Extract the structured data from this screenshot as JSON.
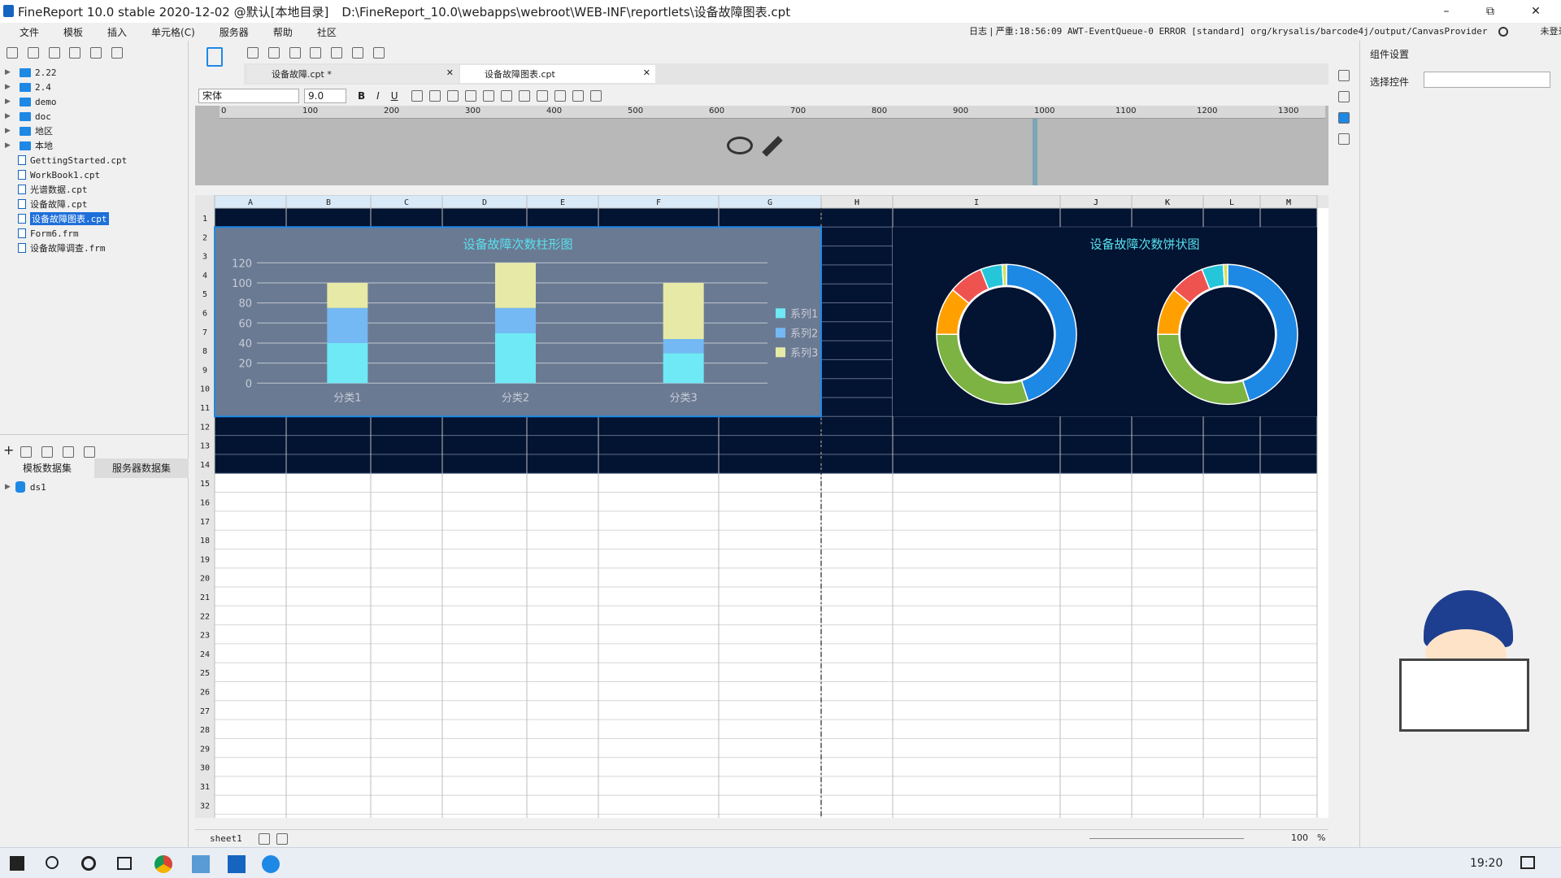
{
  "titlebar": {
    "app": "FineReport 10.0 stable 2020-12-02 @默认[本地目录]",
    "path": "D:\\FineReport_10.0\\webapps\\webroot\\WEB-INF\\reportlets\\设备故障图表.cpt",
    "min": "–",
    "max": "⧉",
    "close": "✕"
  },
  "menu": [
    "文件",
    "模板",
    "插入",
    "单元格(C)",
    "服务器",
    "帮助",
    "社区"
  ],
  "log": {
    "label": "日志",
    "text": "严重:18:56:09 AWT-EventQueue-0 ERROR [standard] org/krysalis/barcode4j/output/CanvasProvider",
    "login": "未登录"
  },
  "tree": [
    {
      "type": "folder",
      "label": "2.22"
    },
    {
      "type": "folder",
      "label": "2.4"
    },
    {
      "type": "folder",
      "label": "demo"
    },
    {
      "type": "folder",
      "label": "doc"
    },
    {
      "type": "folder",
      "label": "地区"
    },
    {
      "type": "folder",
      "label": "本地"
    },
    {
      "type": "file",
      "label": "GettingStarted.cpt"
    },
    {
      "type": "file",
      "label": "WorkBook1.cpt"
    },
    {
      "type": "file",
      "label": "光谱数据.cpt"
    },
    {
      "type": "file",
      "label": "设备故障.cpt"
    },
    {
      "type": "file",
      "label": "设备故障图表.cpt",
      "selected": true
    },
    {
      "type": "file",
      "label": "Form6.frm"
    },
    {
      "type": "file",
      "label": "设备故障调查.frm"
    }
  ],
  "datasets": {
    "tab1": "模板数据集",
    "tab2": "服务器数据集",
    "items": [
      "ds1"
    ]
  },
  "tabs": [
    {
      "label": "设备故障.cpt *"
    },
    {
      "label": "设备故障图表.cpt"
    }
  ],
  "toolbar": {
    "font": "宋体",
    "size": "9.0",
    "bold": "B",
    "italic": "I",
    "underline": "U"
  },
  "ruler": [
    "0",
    "100",
    "200",
    "300",
    "400",
    "500",
    "600",
    "700",
    "800",
    "900",
    "1000",
    "1100",
    "1200",
    "1300"
  ],
  "columns": [
    "A",
    "B",
    "C",
    "D",
    "E",
    "F",
    "G",
    "H",
    "I",
    "J",
    "K",
    "L",
    "M"
  ],
  "rows": [
    "1",
    "2",
    "3",
    "4",
    "5",
    "6",
    "7",
    "8",
    "9",
    "10",
    "11",
    "12",
    "13",
    "14",
    "15",
    "16",
    "17",
    "18",
    "19",
    "20",
    "21",
    "22",
    "23",
    "24",
    "25",
    "26",
    "27",
    "28",
    "29",
    "30",
    "31",
    "32"
  ],
  "chart_data": [
    {
      "type": "bar",
      "title": "设备故障次数柱形图",
      "categories": [
        "分类1",
        "分类2",
        "分类3"
      ],
      "series": [
        {
          "name": "系列1",
          "values": [
            40,
            50,
            30
          ],
          "color": "#6ee9f5"
        },
        {
          "name": "系列2",
          "values": [
            35,
            25,
            14
          ],
          "color": "#74b8f4"
        },
        {
          "name": "系列3",
          "values": [
            25,
            45,
            56
          ],
          "color": "#e6eaa6"
        }
      ],
      "ylim": [
        0,
        120
      ],
      "yticks": [
        "0",
        "20",
        "40",
        "60",
        "80",
        "100",
        "120"
      ],
      "stacked": true,
      "legend": "right"
    },
    {
      "type": "pie",
      "title": "设备故障次数饼状图",
      "donuts": 2,
      "slices": [
        {
          "value": 45,
          "color": "#1e88e5"
        },
        {
          "value": 30,
          "color": "#7cb342"
        },
        {
          "value": 11,
          "color": "#ffa000"
        },
        {
          "value": 8,
          "color": "#ef5350"
        },
        {
          "value": 5,
          "color": "#26c6da"
        },
        {
          "value": 1,
          "color": "#d4e157"
        }
      ]
    }
  ],
  "right": {
    "title": "组件设置",
    "label": "选择控件"
  },
  "sheet": {
    "name": "sheet1",
    "zoom": "100",
    "pct": "%"
  },
  "taskbar": {
    "time": "19:20"
  }
}
